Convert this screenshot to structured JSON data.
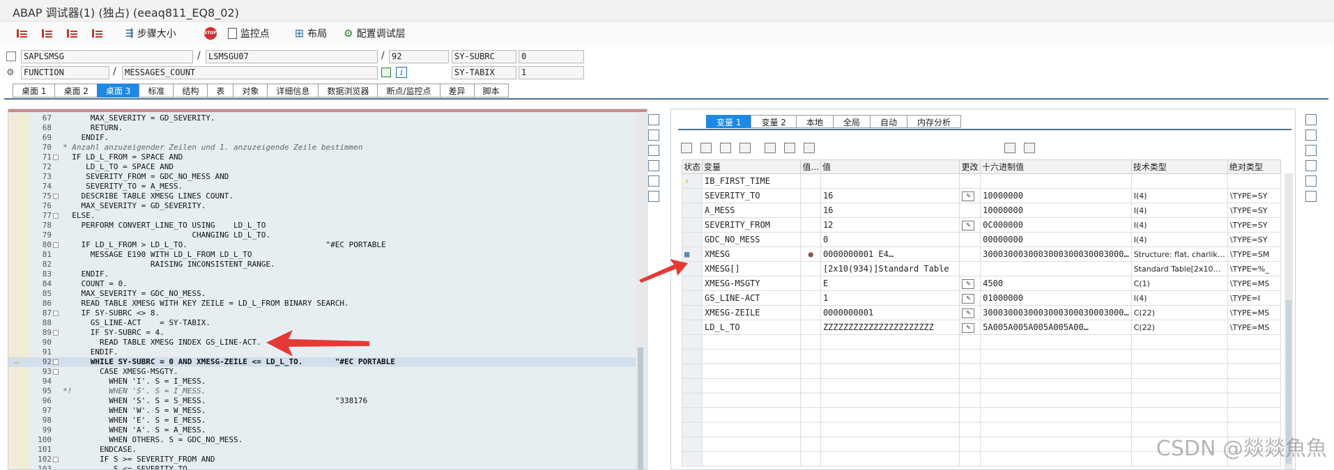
{
  "window": {
    "title": "ABAP 调试器(1)  (独占) (eeaq811_EQ8_02)"
  },
  "toolbar": {
    "step_buttons": [
      "step-into",
      "step-over",
      "step-return",
      "continue"
    ],
    "step_size": "步骤大小",
    "watchpoint": "监控点",
    "layout": "布局",
    "config_layer": "配置调试层"
  },
  "info": {
    "program": "SAPLSMSG",
    "include": "LSMSGU07",
    "line": "92",
    "subrc_label": "SY-SUBRC",
    "subrc_value": "0",
    "event_type": "FUNCTION",
    "event_name": "MESSAGES_COUNT",
    "tabix_label": "SY-TABIX",
    "tabix_value": "1"
  },
  "tabs": [
    "桌面 1",
    "桌面 2",
    "桌面 3",
    "标准",
    "结构",
    "表",
    "对象",
    "详细信息",
    "数据浏览器",
    "断点/监控点",
    "差异",
    "脚本"
  ],
  "code": [
    {
      "n": "67",
      "t": "      MAX_SEVERITY = GD_SEVERITY.",
      "c": false
    },
    {
      "n": "68",
      "t": "      RETURN.",
      "c": false
    },
    {
      "n": "69",
      "t": "    ENDIF.",
      "c": false
    },
    {
      "n": "70",
      "t": "* Anzahl anzuzeigender Zeilen und 1. anzuzeigende Zeile bestimmen",
      "c": true
    },
    {
      "n": "71",
      "t": "  IF LD_L_FROM = SPACE AND",
      "c": false
    },
    {
      "n": "72",
      "t": "     LD_L_TO = SPACE AND",
      "c": false
    },
    {
      "n": "73",
      "t": "     SEVERITY_FROM = GDC_NO_MESS AND",
      "c": false
    },
    {
      "n": "74",
      "t": "     SEVERITY_TO = A_MESS.",
      "c": false
    },
    {
      "n": "75",
      "t": "    DESCRIBE TABLE XMESG LINES COUNT.",
      "c": false
    },
    {
      "n": "76",
      "t": "    MAX_SEVERITY = GD_SEVERITY.",
      "c": false
    },
    {
      "n": "77",
      "t": "  ELSE.",
      "c": false
    },
    {
      "n": "78",
      "t": "    PERFORM CONVERT_LINE_TO USING    LD_L_TO",
      "c": false
    },
    {
      "n": "79",
      "t": "                            CHANGING LD_L_TO.",
      "c": false
    },
    {
      "n": "80",
      "t": "    IF LD_L_FROM > LD_L_TO.                              \"#EC PORTABLE",
      "c": false
    },
    {
      "n": "81",
      "t": "      MESSAGE E190 WITH LD_L_FROM LD_L_TO",
      "c": false
    },
    {
      "n": "82",
      "t": "                   RAISING INCONSISTENT_RANGE.",
      "c": false
    },
    {
      "n": "83",
      "t": "    ENDIF.",
      "c": false
    },
    {
      "n": "84",
      "t": "    COUNT = 0.",
      "c": false
    },
    {
      "n": "85",
      "t": "    MAX_SEVERITY = GDC_NO_MESS.",
      "c": false
    },
    {
      "n": "86",
      "t": "    READ TABLE XMESG WITH KEY ZEILE = LD_L_FROM BINARY SEARCH.",
      "c": false
    },
    {
      "n": "87",
      "t": "    IF SY-SUBRC <> 8.",
      "c": false
    },
    {
      "n": "88",
      "t": "      GS_LINE-ACT    = SY-TABIX.",
      "c": false
    },
    {
      "n": "89",
      "t": "      IF SY-SUBRC = 4.",
      "c": false
    },
    {
      "n": "90",
      "t": "        READ TABLE XMESG INDEX GS_LINE-ACT.",
      "c": false
    },
    {
      "n": "91",
      "t": "      ENDIF.",
      "c": false
    },
    {
      "n": "92",
      "t": "      WHILE SY-SUBRC = 0 AND XMESG-ZEILE <= LD_L_TO.       \"#EC PORTABLE",
      "c": false,
      "cur": true
    },
    {
      "n": "93",
      "t": "        CASE XMESG-MSGTY.",
      "c": false
    },
    {
      "n": "94",
      "t": "          WHEN 'I'. S = I_MESS.",
      "c": false
    },
    {
      "n": "95",
      "t": "*!        WHEN 'S'. S = I_MESS.",
      "c": true
    },
    {
      "n": "96",
      "t": "          WHEN 'S'. S = S_MESS.                            \"338176",
      "c": false
    },
    {
      "n": "97",
      "t": "          WHEN 'W'. S = W_MESS.",
      "c": false
    },
    {
      "n": "98",
      "t": "          WHEN 'E'. S = E_MESS.",
      "c": false
    },
    {
      "n": "99",
      "t": "          WHEN 'A'. S = A_MESS.",
      "c": false
    },
    {
      "n": "100",
      "t": "          WHEN OTHERS. S = GDC_NO_MESS.",
      "c": false
    },
    {
      "n": "101",
      "t": "        ENDCASE.",
      "c": false
    },
    {
      "n": "102",
      "t": "        IF S >= SEVERITY_FROM AND",
      "c": false
    },
    {
      "n": "103",
      "t": "           S <= SEVERITY_TO",
      "c": false
    }
  ],
  "var_tabs": [
    "变量 1",
    "变量 2",
    "本地",
    "全局",
    "自动",
    "内存分析"
  ],
  "var_columns": [
    "状态",
    "变量",
    "值...",
    "值",
    "更改",
    "十六进制值",
    "技术类型",
    "绝对类型"
  ],
  "var_rows": [
    {
      "status": "⚡",
      "name": "IB_FIRST_TIME",
      "icon": "",
      "value": "",
      "edit": false,
      "hex": "",
      "tech": "",
      "abs": ""
    },
    {
      "status": "",
      "name": "SEVERITY_TO",
      "icon": "",
      "value": "16",
      "edit": true,
      "hex": "10000000",
      "tech": "I(4)",
      "abs": "\\TYPE=SY"
    },
    {
      "status": "",
      "name": "A_MESS",
      "icon": "",
      "value": "16",
      "edit": false,
      "hex": "10000000",
      "tech": "I(4)",
      "abs": "\\TYPE=SY"
    },
    {
      "status": "",
      "name": "SEVERITY_FROM",
      "icon": "",
      "value": "12",
      "edit": true,
      "hex": "0C000000",
      "tech": "I(4)",
      "abs": "\\TYPE=SY"
    },
    {
      "status": "",
      "name": "GDC_NO_MESS",
      "icon": "",
      "value": "0",
      "edit": false,
      "hex": "00000000",
      "tech": "I(4)",
      "abs": "\\TYPE=SY"
    },
    {
      "status": "▦",
      "name": "XMESG",
      "icon": "●",
      "value": "0000000001        E4…",
      "edit": false,
      "hex": "3000300030003000300030003000…",
      "tech": "Structure: flat, charlik…",
      "abs": "\\TYPE=SM"
    },
    {
      "status": "",
      "name": "XMESG[]",
      "icon": "",
      "value": "[2x10(934)]Standard Table",
      "edit": false,
      "hex": "",
      "tech": "Standard Table[2x10…",
      "abs": "\\TYPE=%_"
    },
    {
      "status": "",
      "name": "XMESG-MSGTY",
      "icon": "",
      "value": "E",
      "edit": true,
      "hex": "4500",
      "tech": "C(1)",
      "abs": "\\TYPE=MS"
    },
    {
      "status": "",
      "name": "GS_LINE-ACT",
      "icon": "",
      "value": "1",
      "edit": true,
      "hex": "01000000",
      "tech": "I(4)",
      "abs": "\\TYPE=I"
    },
    {
      "status": "",
      "name": "XMESG-ZEILE",
      "icon": "",
      "value": "0000000001",
      "edit": true,
      "hex": "3000300030003000300030003000…",
      "tech": "C(22)",
      "abs": "\\TYPE=MS"
    },
    {
      "status": "",
      "name": "LD_L_TO",
      "icon": "",
      "value": "ZZZZZZZZZZZZZZZZZZZZZZ",
      "edit": true,
      "hex": "5A005A005A005A005A00…",
      "tech": "C(22)",
      "abs": "\\TYPE=MS"
    }
  ],
  "empty_rows": 9,
  "watermark": "CSDN @燚燚魚魚",
  "colors": {
    "accent": "#1e88e5",
    "arrow": "#e53935",
    "code_bg": "#e6eef2"
  }
}
